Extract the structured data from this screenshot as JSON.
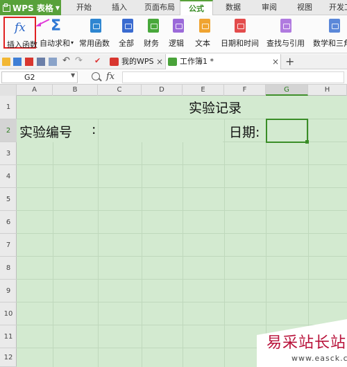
{
  "app": {
    "name": "WPS 表格"
  },
  "menu_tabs": [
    "开始",
    "插入",
    "页面布局",
    "公式",
    "数据",
    "审阅",
    "视图",
    "开发工具"
  ],
  "active_menu_tab": "公式",
  "ribbon": {
    "insert_function": "插入函数",
    "autosum": "自动求和",
    "common_functions": "常用函数",
    "all": "全部",
    "finance": "财务",
    "logic": "逻辑",
    "text": "文本",
    "datetime": "日期和时间",
    "lookup": "查找与引用",
    "math_trig": "数学和三角"
  },
  "doc_tabs": [
    {
      "label": "我的WPS"
    },
    {
      "label": "工作簿1 *"
    }
  ],
  "formula_bar": {
    "name_box": "G2",
    "fx": "fx",
    "formula": ""
  },
  "columns": [
    "A",
    "B",
    "C",
    "D",
    "E",
    "F",
    "G",
    "H"
  ],
  "selected_column": "G",
  "rows": [
    "1",
    "2",
    "3",
    "4",
    "5",
    "6",
    "7",
    "8",
    "9",
    "10",
    "11",
    "12"
  ],
  "selected_row": "2",
  "cells": {
    "title": "实验记录",
    "experiment_no": "实验编号",
    "colon": ":",
    "date": "日期:"
  },
  "watermark": {
    "text": "易采站长站",
    "url": "www.easck.com"
  },
  "colors": {
    "accent": "#58a13a",
    "sheet_fill": "#d3ead0",
    "highlight": "#e02020"
  }
}
